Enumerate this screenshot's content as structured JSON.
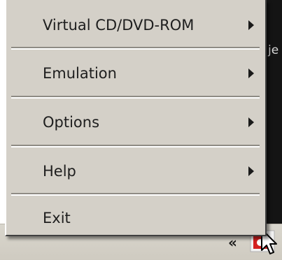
{
  "background": {
    "window_text": "je",
    "tray_chevron": "«"
  },
  "menu": {
    "items": [
      {
        "label": "Virtual CD/DVD-ROM",
        "has_submenu": true
      },
      {
        "label": "Emulation",
        "has_submenu": true
      },
      {
        "label": "Options",
        "has_submenu": true
      },
      {
        "label": "Help",
        "has_submenu": true
      },
      {
        "label": "Exit",
        "has_submenu": false
      }
    ]
  },
  "colors": {
    "menu_background": "#d4d0c8",
    "text": "#1e1e1e",
    "tray_icon_red": "#d42020"
  },
  "icons": [
    "submenu-arrow-icon",
    "tray-app-icon",
    "mouse-cursor-icon"
  ]
}
